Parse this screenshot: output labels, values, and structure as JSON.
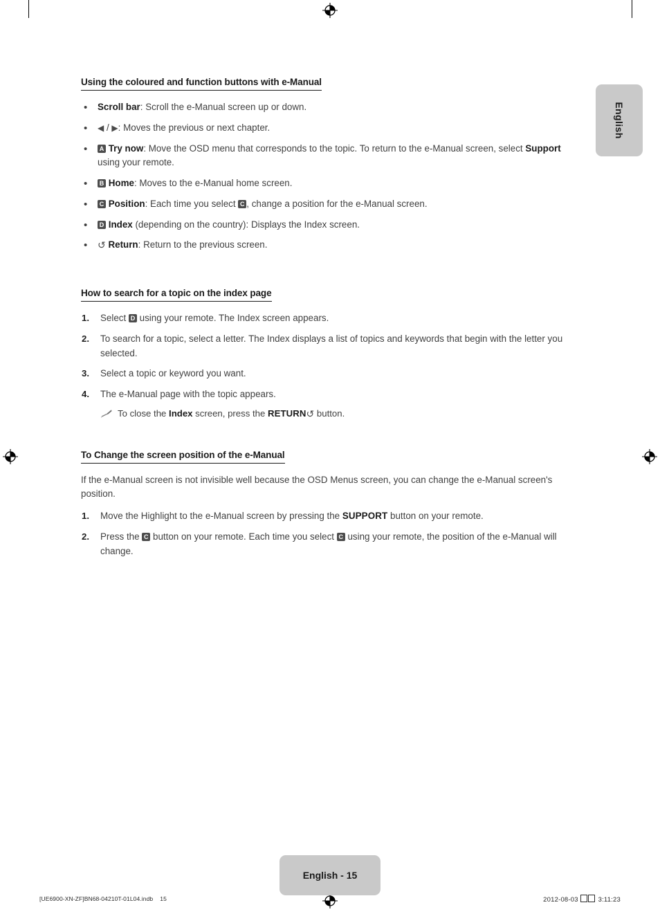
{
  "page": {
    "language_tab": "English",
    "page_badge": "English - 15"
  },
  "sections": [
    {
      "id": "coloured-buttons",
      "heading": "Using the coloured and function buttons with e-Manual",
      "bullets": [
        {
          "key_icon": null,
          "label": "Scroll bar",
          "label_sep": ": ",
          "text": "Scroll the e-Manual screen up or down."
        },
        {
          "key_icon": "arrows",
          "arrow_left": "◀",
          "arrow_sep": " / ",
          "arrow_right": "▶",
          "label": null,
          "label_sep": ": ",
          "text": "Moves the previous or next chapter."
        },
        {
          "key_icon": "A",
          "label": "Try now",
          "label_sep": ": ",
          "text_part1": "Move the OSD menu that corresponds to the topic. To return to the e-Manual screen, select ",
          "inline_bold": "Support",
          "text_part2": " using your remote."
        },
        {
          "key_icon": "B",
          "label": "Home",
          "label_sep": ": ",
          "text": "Moves to the e-Manual home screen."
        },
        {
          "key_icon": "C",
          "label": "Position",
          "label_sep": ": ",
          "text_part1": "Each time you select ",
          "inline_key": "C",
          "text_part2": ", change a position for the e-Manual screen."
        },
        {
          "key_icon": "D",
          "label": "Index",
          "label_sep": " ",
          "text": "(depending on the country): Displays the Index screen."
        },
        {
          "key_icon": "return",
          "return_glyph": "↺",
          "label": "Return",
          "label_sep": ": ",
          "text": "Return to the previous screen."
        }
      ]
    },
    {
      "id": "search-index",
      "heading": "How to search for a topic on the index page",
      "steps": [
        {
          "num": "1.",
          "text_part1": "Select ",
          "inline_key": "D",
          "text_part2": " using your remote. The Index screen appears."
        },
        {
          "num": "2.",
          "text": "To search for a topic, select a letter. The Index displays a list of topics and keywords that begin with the letter you selected."
        },
        {
          "num": "3.",
          "text": "Select a topic or keyword you want."
        },
        {
          "num": "4.",
          "text": "The e-Manual page with the topic appears.",
          "note": {
            "icon": "pencil-icon",
            "text_part1": "To close the ",
            "inline_bold": "Index",
            "text_part2": " screen, press the ",
            "inline_caps": "RETURN",
            "return_glyph": "↺",
            "text_part3": " button."
          }
        }
      ]
    },
    {
      "id": "change-position",
      "heading": "To Change the screen position of the e-Manual",
      "paragraph": "If the e-Manual screen is not invisible well because the OSD Menus screen, you can change the e-Manual screen's position.",
      "steps": [
        {
          "num": "1.",
          "text_part1": "Move the Highlight to the e-Manual screen by pressing the ",
          "inline_caps": "SUPPORT",
          "text_part2": " button on your remote."
        },
        {
          "num": "2.",
          "text_part1": "Press the ",
          "inline_key1": "C",
          "text_part2": " button on your remote. Each time you select ",
          "inline_key2": "C",
          "text_part3": " using your remote, the position of the e-Manual will change."
        }
      ]
    }
  ],
  "footer": {
    "file_name": "[UE6900-XN-ZF]BN68-04210T-01L04.indb",
    "file_page": "15",
    "date": "2012-08-03",
    "time": "3:11:23"
  },
  "colors": {
    "key_badge": "#4d4d4d",
    "tab_gray": "#c9c9c9",
    "body_text": "#3f3f3f",
    "heading_text": "#1a1a1a"
  }
}
